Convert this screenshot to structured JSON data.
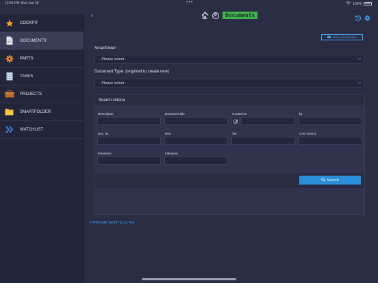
{
  "statusbar": {
    "time": "12:55 PM  Wed Jun 29",
    "dots": "•••",
    "battery": "100%"
  },
  "sidebar": {
    "items": [
      {
        "label": "COCKPIT",
        "icon": "star-icon"
      },
      {
        "label": "DOCUMENTS",
        "icon": "document-icon"
      },
      {
        "label": "PARTS",
        "icon": "gear-icon"
      },
      {
        "label": "TASKS",
        "icon": "task-list-icon"
      },
      {
        "label": "PROJECTS",
        "icon": "projects-icon"
      },
      {
        "label": "SMARTFOLDER",
        "icon": "folder-icon"
      },
      {
        "label": "WATCHLIST",
        "icon": "double-chevron-icon"
      }
    ],
    "active": "DOCUMENTS"
  },
  "header": {
    "back": "‹",
    "p_label": "P",
    "title": "Documents"
  },
  "main": {
    "smartfolder_button": "All to smartfolders",
    "smartfolder_label": "Smartfolder:",
    "smartfolder_value": "- Please select -",
    "doctype_label": "Document Type: (required to create new)",
    "doctype_value": "- Please select -",
    "criteria_title": "Search criteria",
    "fields": {
      "description": "Description",
      "document_title": "Document title",
      "created_on": "created on",
      "by": "by",
      "doc_id": "Doc. ID.",
      "rev": "Rev.",
      "ver": "Ver.",
      "cad_version": "CAD version",
      "extension": "Extension",
      "filename": "Filename"
    },
    "search_button": "Search"
  },
  "footer": {
    "copyright": "PROCAD GmbH & Co. KG"
  },
  "colors": {
    "accent": "#3ea2e6",
    "title_bg": "#3fb34f",
    "background": "#2b2d45",
    "sidebar": "#23253a"
  }
}
